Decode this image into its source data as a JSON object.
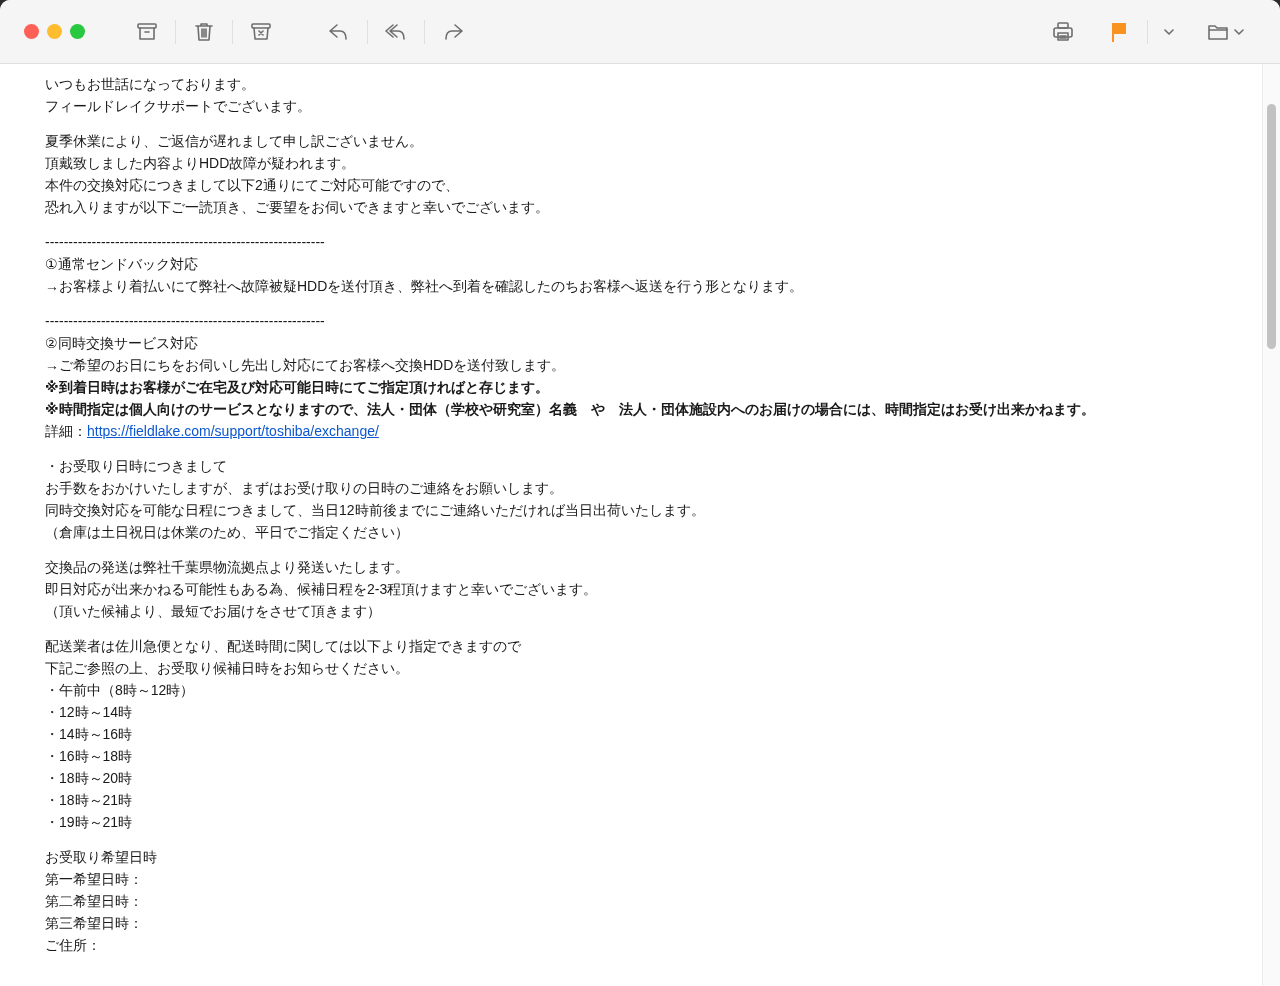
{
  "toolbar": {
    "buttons": [
      {
        "kind": "archive"
      },
      {
        "kind": "trash"
      },
      {
        "kind": "junk"
      },
      {
        "kind": "reply"
      },
      {
        "kind": "reply-all"
      },
      {
        "kind": "forward"
      }
    ],
    "right": [
      {
        "kind": "print"
      },
      {
        "kind": "flag"
      },
      {
        "kind": "folder"
      }
    ]
  },
  "message": {
    "blocks": [
      {
        "lines": [
          {
            "kind": "text",
            "text": "いつもお世話になっております。"
          },
          {
            "kind": "text",
            "text": "フィールドレイクサポートでございます。"
          }
        ]
      },
      {
        "lines": [
          {
            "kind": "text",
            "text": "夏季休業により、ご返信が遅れまして申し訳ございません。"
          },
          {
            "kind": "text",
            "text": "頂戴致しました内容よりHDD故障が疑われます。"
          },
          {
            "kind": "text",
            "text": "本件の交換対応につきまして以下2通りにてご対応可能ですので、"
          },
          {
            "kind": "text",
            "text": "恐れ入りますが以下ご一読頂き、ご要望をお伺いできますと幸いでございます。"
          }
        ]
      },
      {
        "lines": [
          {
            "kind": "rule",
            "text": "------------------------------------------------------------"
          },
          {
            "kind": "text",
            "text": "①通常センドバック対応"
          },
          {
            "kind": "text",
            "text": "→お客様より着払いにて弊社へ故障被疑HDDを送付頂き、弊社へ到着を確認したのちお客様へ返送を行う形となります。"
          }
        ]
      },
      {
        "lines": [
          {
            "kind": "rule",
            "text": "------------------------------------------------------------"
          },
          {
            "kind": "text",
            "text": "②同時交換サービス対応"
          },
          {
            "kind": "text",
            "text": "→ご希望のお日にちをお伺いし先出し対応にてお客様へ交換HDDを送付致します。"
          },
          {
            "kind": "bold",
            "text": "※到着日時はお客様がご在宅及び対応可能日時にてご指定頂ければと存じます。"
          },
          {
            "kind": "bold",
            "text": "※時間指定は個人向けのサービスとなりますので、法人・団体（学校や研究室）名義　や　法人・団体施設内へのお届けの場合には、時間指定はお受け出来かねます。"
          },
          {
            "kind": "link",
            "text": "詳細：",
            "link": "https://fieldlake.com/support/toshiba/exchange/"
          }
        ]
      },
      {
        "lines": [
          {
            "kind": "text",
            "text": "・お受取り日時につきまして"
          },
          {
            "kind": "text",
            "text": "お手数をおかけいたしますが、まずはお受け取りの日時のご連絡をお願いします。"
          },
          {
            "kind": "text",
            "text": "同時交換対応を可能な日程につきまして、当日12時前後までにご連絡いただければ当日出荷いたします。"
          },
          {
            "kind": "text",
            "text": "（倉庫は土日祝日は休業のため、平日でご指定ください）"
          }
        ]
      },
      {
        "lines": [
          {
            "kind": "text",
            "text": "交換品の発送は弊社千葉県物流拠点より発送いたします。"
          },
          {
            "kind": "text",
            "text": "即日対応が出来かねる可能性もある為、候補日程を2-3程頂けますと幸いでございます。"
          },
          {
            "kind": "text",
            "text": "（頂いた候補より、最短でお届けをさせて頂きます）"
          }
        ]
      },
      {
        "lines": [
          {
            "kind": "text",
            "text": "配送業者は佐川急便となり、配送時間に関しては以下より指定できますので"
          },
          {
            "kind": "text",
            "text": "下記ご参照の上、お受取り候補日時をお知らせください。"
          },
          {
            "kind": "text",
            "text": "・午前中（8時～12時）"
          },
          {
            "kind": "text",
            "text": "・12時～14時"
          },
          {
            "kind": "text",
            "text": "・14時～16時"
          },
          {
            "kind": "text",
            "text": "・16時～18時"
          },
          {
            "kind": "text",
            "text": "・18時～20時"
          },
          {
            "kind": "text",
            "text": "・18時～21時"
          },
          {
            "kind": "text",
            "text": "・19時～21時"
          }
        ]
      },
      {
        "lines": [
          {
            "kind": "text",
            "text": "お受取り希望日時"
          },
          {
            "kind": "text",
            "text": "第一希望日時："
          },
          {
            "kind": "text",
            "text": "第二希望日時："
          },
          {
            "kind": "text",
            "text": "第三希望日時："
          },
          {
            "kind": "text",
            "text": "ご住所："
          }
        ]
      }
    ]
  }
}
